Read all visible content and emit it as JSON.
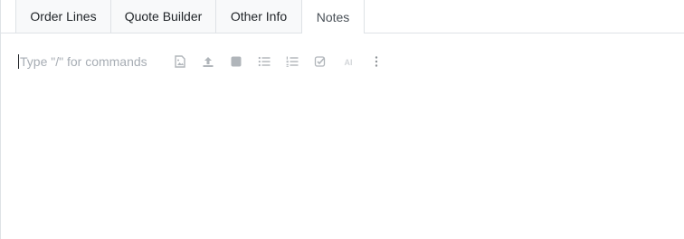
{
  "tabs": [
    {
      "label": "Order Lines",
      "active": false
    },
    {
      "label": "Quote Builder",
      "active": false
    },
    {
      "label": "Other Info",
      "active": false
    },
    {
      "label": "Notes",
      "active": true
    }
  ],
  "editor": {
    "placeholder": "Type \"/\" for commands"
  },
  "toolbar": {
    "icons": [
      "image-icon",
      "upload-icon",
      "square-icon",
      "bulleted-list-icon",
      "numbered-list-icon",
      "checklist-icon",
      "ai-icon",
      "more-vertical-icon"
    ],
    "ai_label": "AI"
  },
  "colors": {
    "icon": "#b0b5ba",
    "placeholder": "#a7adb4",
    "border": "#dee2e6",
    "tab_text": "#212529"
  }
}
